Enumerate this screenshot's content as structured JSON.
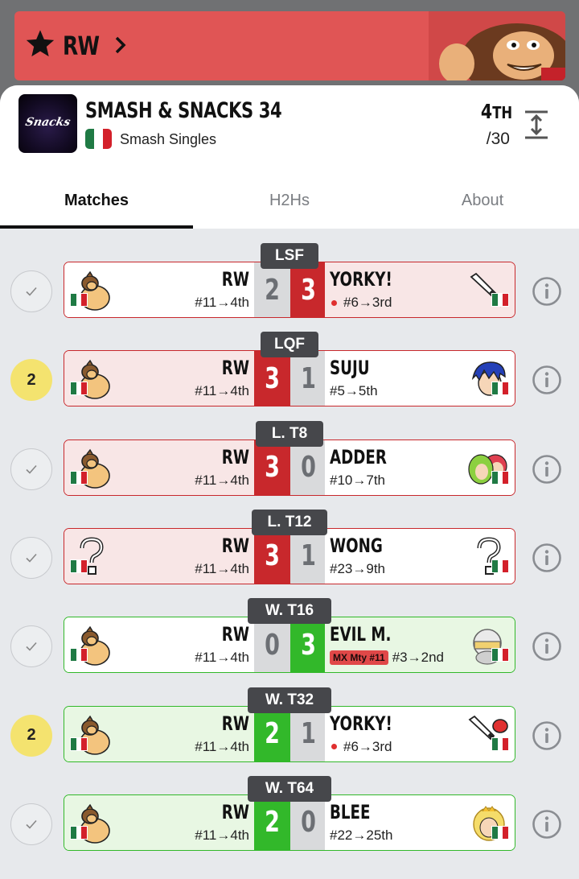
{
  "banner": {
    "player_name": "RW",
    "icons": [
      "star-icon",
      "chevron-right-icon"
    ],
    "bg_color": "#e05555"
  },
  "tournament": {
    "name": "SMASH & SNACKS 34",
    "logo_text": "Snacks",
    "event": "Smash Singles",
    "placement_num": "4",
    "placement_suffix": "TH",
    "total": "/30"
  },
  "tabs": [
    {
      "label": "Matches",
      "active": true
    },
    {
      "label": "H2Hs",
      "active": false
    },
    {
      "label": "About",
      "active": false
    }
  ],
  "matches": [
    {
      "round": "LSF",
      "status": "",
      "left": {
        "name": "RW",
        "seed": "#11→4th",
        "char": "donkey-kong"
      },
      "score_left": "2",
      "score_right": "3",
      "right": {
        "name": "YORKY!",
        "seed": "#6→3rd",
        "dot": true,
        "char": "sword"
      },
      "result": "loss"
    },
    {
      "round": "LQF",
      "status": "2",
      "left": {
        "name": "RW",
        "seed": "#11→4th",
        "char": "donkey-kong"
      },
      "score_left": "3",
      "score_right": "1",
      "right": {
        "name": "SUJU",
        "seed": "#5→5th",
        "char": "blue-hair"
      },
      "result": "win-red"
    },
    {
      "round": "L. T8",
      "status": "",
      "left": {
        "name": "RW",
        "seed": "#11→4th",
        "char": "donkey-kong"
      },
      "score_left": "3",
      "score_right": "0",
      "right": {
        "name": "ADDER",
        "seed": "#10→7th",
        "char": "green-red-duo"
      },
      "result": "win-red"
    },
    {
      "round": "L. T12",
      "status": "",
      "left": {
        "name": "RW",
        "seed": "#11→4th",
        "char": "unknown"
      },
      "score_left": "3",
      "score_right": "1",
      "right": {
        "name": "WONG",
        "seed": "#23→9th",
        "char": "unknown"
      },
      "result": "win-red"
    },
    {
      "round": "W. T16",
      "status": "",
      "left": {
        "name": "RW",
        "seed": "#11→4th",
        "char": "donkey-kong"
      },
      "score_left": "0",
      "score_right": "3",
      "right": {
        "name": "EVIL M.",
        "seed": "#3→2nd",
        "badge": "MX Mty #11",
        "char": "helmet"
      },
      "result": "loss-green"
    },
    {
      "round": "W. T32",
      "status": "2",
      "left": {
        "name": "RW",
        "seed": "#11→4th",
        "char": "donkey-kong"
      },
      "score_left": "2",
      "score_right": "1",
      "right": {
        "name": "YORKY!",
        "seed": "#6→3rd",
        "dot": true,
        "char": "sword-red"
      },
      "result": "win-green"
    },
    {
      "round": "W. T64",
      "status": "",
      "left": {
        "name": "RW",
        "seed": "#11→4th",
        "char": "donkey-kong"
      },
      "score_left": "2",
      "score_right": "0",
      "right": {
        "name": "BLEE",
        "seed": "#22→25th",
        "char": "blonde"
      },
      "result": "win-green"
    }
  ],
  "colors": {
    "loss_red": "#c8282c",
    "win_green": "#32b82a",
    "round_badge": "#46474b",
    "status_yellow": "#f4e36f"
  }
}
